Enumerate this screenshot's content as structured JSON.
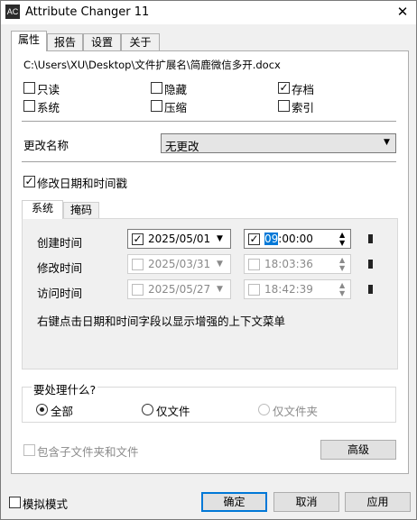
{
  "window": {
    "title": "Attribute Changer 11",
    "icon_text": "AC"
  },
  "tabs": [
    {
      "label": "属性",
      "active": true
    },
    {
      "label": "报告",
      "active": false
    },
    {
      "label": "设置",
      "active": false
    },
    {
      "label": "关于",
      "active": false
    }
  ],
  "file_path": "C:\\Users\\XU\\Desktop\\文件扩展名\\简鹿微信多开.docx",
  "attributes": {
    "readonly": {
      "label": "只读",
      "checked": false
    },
    "hidden": {
      "label": "隐藏",
      "checked": false
    },
    "archive": {
      "label": "存档",
      "checked": true
    },
    "system": {
      "label": "系统",
      "checked": false
    },
    "compressed": {
      "label": "压缩",
      "checked": false
    },
    "indexed": {
      "label": "索引",
      "checked": false
    }
  },
  "rename": {
    "label": "更改名称",
    "value": "无更改"
  },
  "change_datetime": {
    "label": "修改日期和时间戳",
    "checked": true
  },
  "inner_tabs": [
    {
      "label": "系统",
      "active": true
    },
    {
      "label": "掩码",
      "active": false
    }
  ],
  "times": [
    {
      "label": "创建时间",
      "date": "2025/05/01",
      "time_highlight": "09",
      "time_rest": ":00:00",
      "enabled": true,
      "date_checked": true,
      "time_checked": true
    },
    {
      "label": "修改时间",
      "date": "2025/03/31",
      "time_highlight": "",
      "time_rest": "18:03:36",
      "enabled": false,
      "date_checked": false,
      "time_checked": false
    },
    {
      "label": "访问时间",
      "date": "2025/05/27",
      "time_highlight": "",
      "time_rest": "18:42:39",
      "enabled": false,
      "date_checked": false,
      "time_checked": false
    }
  ],
  "hint": "右键点击日期和时间字段以显示增强的上下文菜单",
  "process": {
    "title": "要处理什么?",
    "options": [
      {
        "label": "全部",
        "selected": true,
        "enabled": true
      },
      {
        "label": "仅文件",
        "selected": false,
        "enabled": true
      },
      {
        "label": "仅文件夹",
        "selected": false,
        "enabled": false
      }
    ]
  },
  "include_subfolders": {
    "label": "包含子文件夹和文件",
    "checked": false,
    "enabled": false
  },
  "advanced_button": "高级",
  "simulation_mode": {
    "label": "模拟模式",
    "checked": false
  },
  "buttons": {
    "ok": "确定",
    "cancel": "取消",
    "apply": "应用"
  },
  "colors": {
    "accent": "#0078d7",
    "highlight": "#0078d7"
  },
  "icons": [
    "close-icon",
    "dropdown-arrow-icon",
    "spin-up-icon",
    "spin-down-icon",
    "checkmark-icon"
  ]
}
